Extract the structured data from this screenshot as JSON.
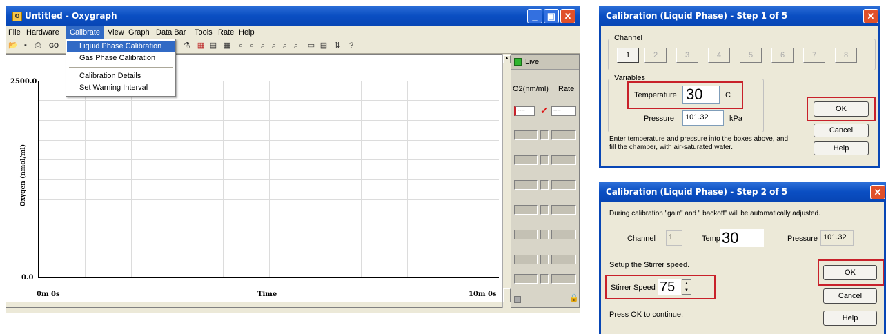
{
  "oxy": {
    "title": "Untitled - Oxygraph",
    "menu": [
      "File",
      "Hardware",
      "Calibrate",
      "View",
      "Graph",
      "Data Bar",
      "Tools",
      "Rate",
      "Help"
    ],
    "go": "GO",
    "dropdown": [
      "Liquid Phase Calibration",
      "Gas Phase Calibration",
      "Calibration Details",
      "Set Warning Interval"
    ],
    "y_max": "2500.0",
    "y_min": "0.0",
    "x_start": "0m 0s",
    "x_label": "Time",
    "x_end": "10m 0s",
    "y_label": "Oxygen (nmol/ml)",
    "live": "Live",
    "col_o2": "O2(nm/ml)",
    "col_rate": "Rate",
    "dash": "----"
  },
  "step1": {
    "title": "Calibration (Liquid Phase) - Step 1 of 5",
    "channel_group": "Channel",
    "channels": [
      "1",
      "2",
      "3",
      "4",
      "5",
      "6",
      "7",
      "8"
    ],
    "variables_group": "Variables",
    "temp_label": "Temperature",
    "temp_value": "30",
    "temp_unit": "C",
    "pressure_label": "Pressure",
    "pressure_value": "101.32",
    "pressure_unit": "kPa",
    "instruction": "Enter temperature and pressure into the boxes above, and fill the chamber, with air-saturated water.",
    "ok": "OK",
    "cancel": "Cancel",
    "help": "Help"
  },
  "step2": {
    "title": "Calibration (Liquid Phase) - Step 2 of 5",
    "info": "During calibration \"gain\" and \" backoff\" will be automatically adjusted.",
    "channel_label": "Channel",
    "channel_value": "1",
    "temp_label": "Temp",
    "temp_value": "30",
    "pressure_label": "Pressure",
    "pressure_value": "101.32",
    "stirrer_text": "Setup the Stirrer speed.",
    "stirrer_label": "Stirrer Speed",
    "stirrer_value": "75",
    "press_ok": "Press OK to continue.",
    "ok": "OK",
    "cancel": "Cancel",
    "help": "Help"
  },
  "colors": {
    "xp_blue": "#0a4ec2",
    "red_highlight": "#c8212a",
    "menu_highlight": "#316ac5",
    "live_green": "#2fb52f"
  }
}
